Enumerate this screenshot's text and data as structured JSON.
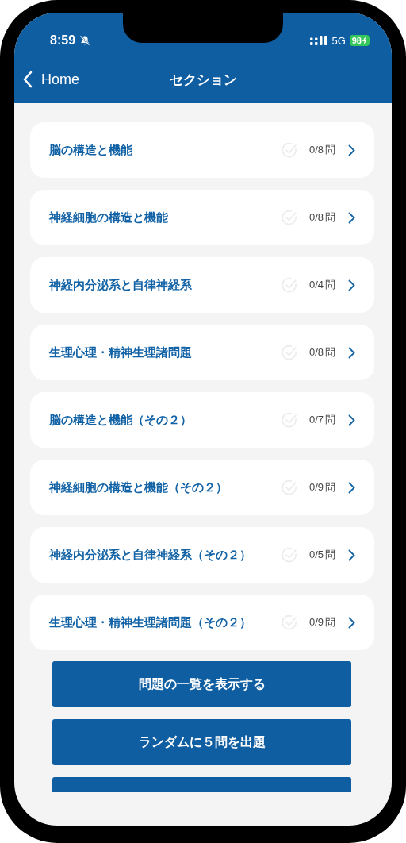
{
  "status_bar": {
    "time": "8:59",
    "network": "5G",
    "battery": "98"
  },
  "nav": {
    "back": "Home",
    "title": "セクション"
  },
  "sections": [
    {
      "title": "脳の構造と機能",
      "progress": "0/8",
      "unit": "問",
      "completed": false
    },
    {
      "title": "神経細胞の構造と機能",
      "progress": "0/8",
      "unit": "問",
      "completed": false
    },
    {
      "title": "神経内分泌系と自律神経系",
      "progress": "0/4",
      "unit": "問",
      "completed": false
    },
    {
      "title": "生理心理・精神生理諸問題",
      "progress": "0/8",
      "unit": "問",
      "completed": false
    },
    {
      "title": "脳の構造と機能（その２）",
      "progress": "0/7",
      "unit": "問",
      "completed": false
    },
    {
      "title": "神経細胞の構造と機能（その２）",
      "progress": "0/9",
      "unit": "問",
      "completed": false
    },
    {
      "title": "神経内分泌系と自律神経系（その２）",
      "progress": "0/5",
      "unit": "問",
      "completed": false
    },
    {
      "title": "生理心理・精神生理諸問題（その２）",
      "progress": "0/9",
      "unit": "問",
      "completed": false
    }
  ],
  "buttons": [
    "問題の一覧を表示する",
    "ランダムに５問を出題"
  ]
}
